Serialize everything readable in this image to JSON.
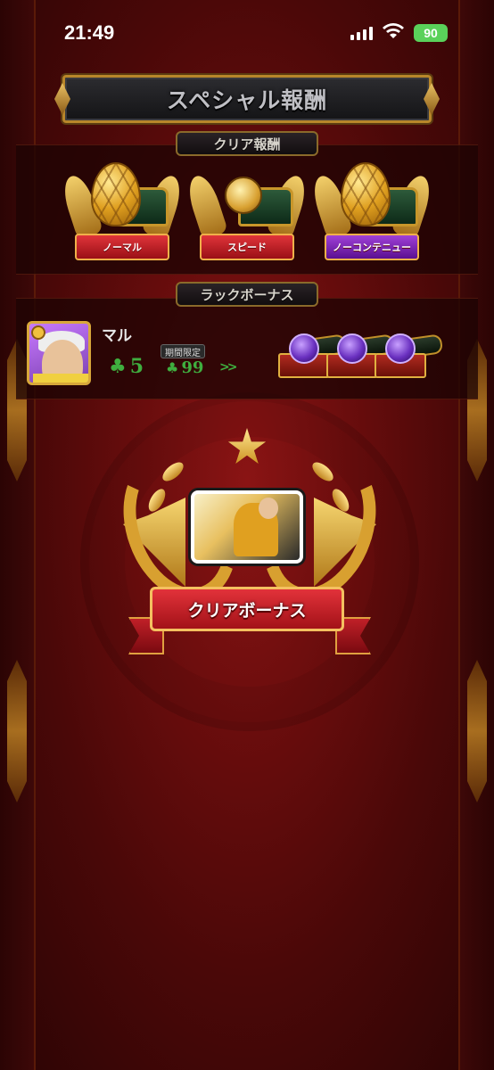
{
  "status_bar": {
    "time": "21:49",
    "battery": "90",
    "icons": [
      "signal-icon",
      "wifi-icon",
      "battery-icon"
    ]
  },
  "title": "スペシャル報酬",
  "clear_rewards": {
    "label": "クリア報酬",
    "items": [
      {
        "label": "ノーマル",
        "icon": "gold-egg-icon",
        "ribbon_color": "#c0181e"
      },
      {
        "label": "スピード",
        "icon": "gold-medal-chest-icon",
        "ribbon_color": "#c0181e"
      },
      {
        "label": "ノーコンテニュー",
        "icon": "gold-egg-icon",
        "ribbon_color": "#8a2ac8"
      }
    ]
  },
  "luck_bonus": {
    "label": "ラックボーナス",
    "character_name": "マル",
    "luck_value": "5",
    "limited_label": "期間限定",
    "limited_luck_value": "99",
    "arrows": ">>",
    "chests": [
      "purple-orb-chest-icon",
      "purple-orb-chest-icon",
      "purple-orb-chest-icon"
    ]
  },
  "clear_bonus": {
    "label": "クリアボーナス",
    "icon": "laurel-star-emblem-icon"
  },
  "colors": {
    "background": "#6a0d0d",
    "gold": "#d8a030",
    "luck_green": "#3fae3f",
    "ribbon_red": "#c0181e",
    "ribbon_purple": "#8a2ac8"
  }
}
